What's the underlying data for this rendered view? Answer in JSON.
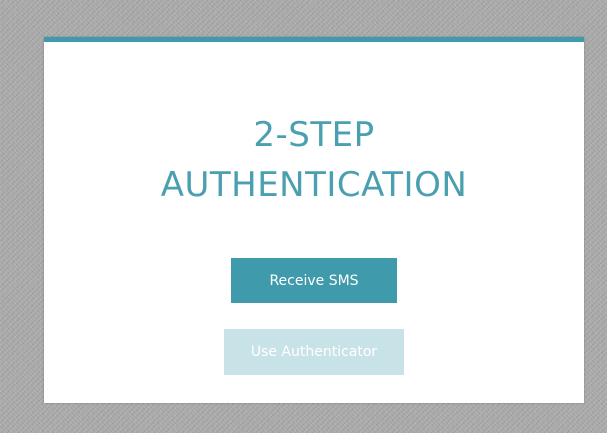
{
  "auth": {
    "title_line1": "2-STEP",
    "title_line2": "AUTHENTICATION",
    "primary_button_label": "Receive SMS",
    "secondary_button_label": "Use Authenticator",
    "secondary_button_state": "disabled"
  },
  "colors": {
    "accent": "#3f9bab",
    "title": "#4a9fb0",
    "disabled_button": "#c8e3e8",
    "card_background": "#ffffff",
    "page_background": "#a9a9a9"
  }
}
